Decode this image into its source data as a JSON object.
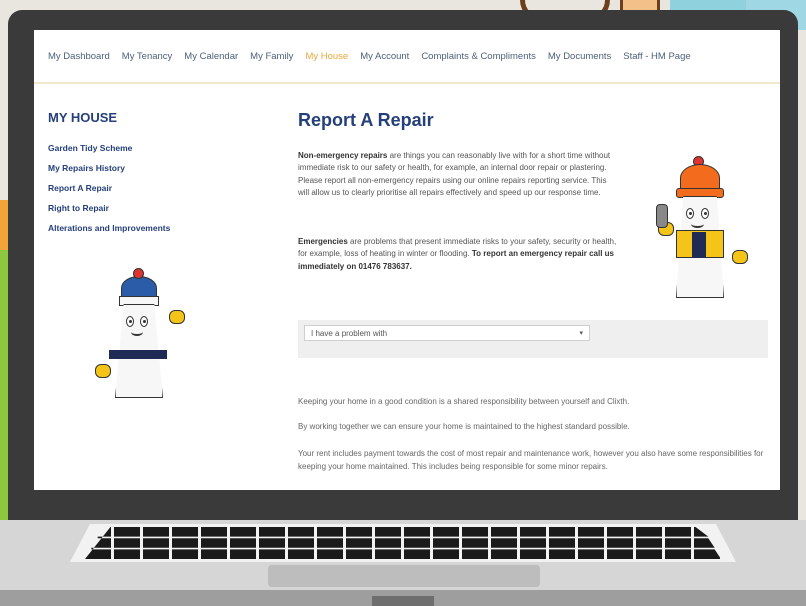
{
  "nav": {
    "items": [
      {
        "label": "My Dashboard"
      },
      {
        "label": "My Tenancy"
      },
      {
        "label": "My Calendar"
      },
      {
        "label": "My Family"
      },
      {
        "label": "My House",
        "active": true
      },
      {
        "label": "My Account"
      },
      {
        "label": "Complaints & Compliments"
      },
      {
        "label": "My Documents"
      },
      {
        "label": "Staff - HM Page"
      }
    ]
  },
  "sidebar": {
    "title": "MY HOUSE",
    "items": [
      {
        "label": "Garden Tidy Scheme"
      },
      {
        "label": "My Repairs History"
      },
      {
        "label": "Report A Repair",
        "current": true
      },
      {
        "label": "Right to Repair"
      },
      {
        "label": "Alterations and Improvements"
      }
    ]
  },
  "main": {
    "title": "Report A Repair",
    "non_emergency_lead": "Non-emergency repairs",
    "non_emergency_text": " are things you can reasonably live with for a short time without immediate risk to our safety or health, for example, an internal door repair or plastering. Please report all non-emergency repairs using our online repairs reporting service. This will allow us to clearly prioritise all repairs effectively and speed up our response time.",
    "emergency_lead": "Emergencies",
    "emergency_text": " are problems that present immediate risks to your safety, security or health, for example, loss of heating in winter or flooding. ",
    "emergency_call": "To report an emergency repair call us immediately on 01476 783637.",
    "dropdown_value": "I have a problem with",
    "body_1": "Keeping your home in a good condition is a shared responsibility between yourself and Clixth.",
    "body_2": "By working together we can ensure your home is maintained to the highest standard possible.",
    "body_3": "Your rent includes payment towards the cost of most repair and maintenance work, however you also have some responsibilities for keeping your home maintained. This includes being responsible for some minor repairs."
  },
  "colors": {
    "nav_active": "#e7a93a",
    "heading": "#243f7a",
    "laptop_bezel": "#3a3a3a"
  }
}
